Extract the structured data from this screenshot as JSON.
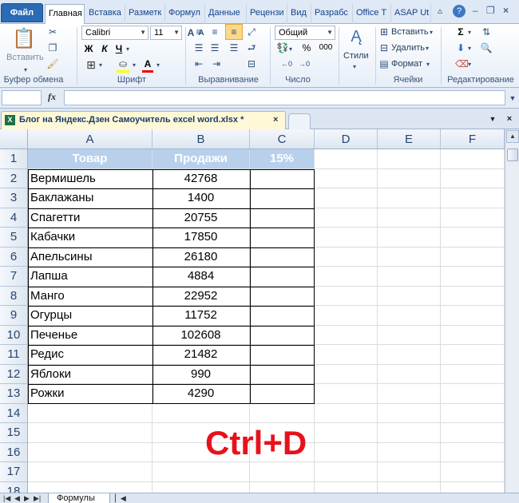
{
  "ribbon_tabs": [
    "Файл",
    "Главная",
    "Вставка",
    "Разметк",
    "Формул",
    "Данные",
    "Рецензи",
    "Вид",
    "Разрабс",
    "Office T",
    "ASAP Ut"
  ],
  "ribbon": {
    "paste_label": "Вставить",
    "font_name": "Calibri",
    "font_size": "11",
    "bold": "Ж",
    "italic": "К",
    "underline": "Ч",
    "font_color_letter": "А",
    "number_format": "Общий",
    "percent": "%",
    "thousands": "000",
    "styles_label": "Стили",
    "insert_label": "Вставить",
    "delete_label": "Удалить",
    "format_label": "Формат",
    "groups": [
      "Буфер обмена",
      "Шрифт",
      "Выравнивание",
      "Число",
      "Ячейки",
      "Редактирование"
    ]
  },
  "formula_bar": {
    "fx": "fx",
    "value": ""
  },
  "workbook": {
    "title": "Блог на Яндекс.Дзен Самоучитель excel word.xlsx *",
    "close": "×"
  },
  "columns": [
    "A",
    "B",
    "C",
    "D",
    "E",
    "F"
  ],
  "rows": [
    "1",
    "2",
    "3",
    "4",
    "5",
    "6",
    "7",
    "8",
    "9",
    "10",
    "11",
    "12",
    "13",
    "14",
    "15",
    "16",
    "17",
    "18"
  ],
  "table": {
    "headers": [
      "Товар",
      "Продажи",
      "15%"
    ],
    "items": [
      {
        "name": "Вермишель",
        "sales": "42768"
      },
      {
        "name": "Баклажаны",
        "sales": "1400"
      },
      {
        "name": "Спагетти",
        "sales": "20755"
      },
      {
        "name": "Кабачки",
        "sales": "17850"
      },
      {
        "name": "Апельсины",
        "sales": "26180"
      },
      {
        "name": "Лапша",
        "sales": "4884"
      },
      {
        "name": "Манго",
        "sales": "22952"
      },
      {
        "name": "Огурцы",
        "sales": "11752"
      },
      {
        "name": "Печенье",
        "sales": "102608"
      },
      {
        "name": "Редис",
        "sales": "21482"
      },
      {
        "name": "Яблоки",
        "sales": "990"
      },
      {
        "name": "Рожки",
        "sales": "4290"
      }
    ]
  },
  "overlay_text": "Ctrl+D",
  "sheet_tab": "Формулы"
}
